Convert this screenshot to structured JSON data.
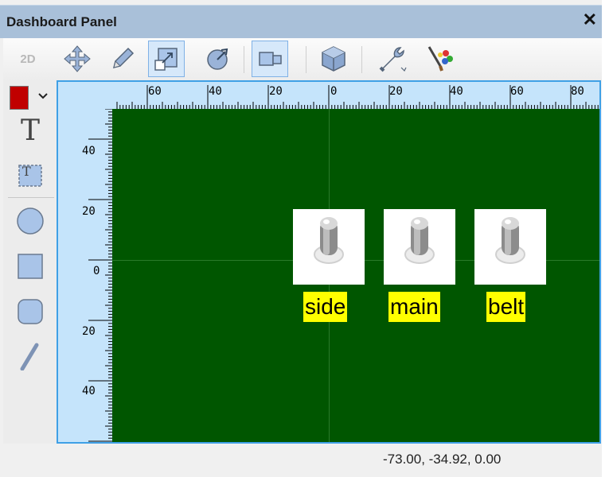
{
  "window": {
    "title": "Dashboard Panel",
    "close_glyph": "✕"
  },
  "toolbar": {
    "mode_label": "2D",
    "buttons": [
      {
        "name": "move-icon",
        "active": false
      },
      {
        "name": "pencil-icon",
        "active": false
      },
      {
        "name": "resize-icon",
        "active": true
      },
      {
        "name": "rotate-icon",
        "active": false
      },
      {
        "name": "attach-icon",
        "active": true
      },
      {
        "name": "cube-icon",
        "active": false
      },
      {
        "name": "wrench-icon",
        "active": false
      },
      {
        "name": "brush-palette-icon",
        "active": false
      }
    ]
  },
  "left_tools": {
    "current_color": "#c00000",
    "text_tool": "T",
    "textbox_tool": "T",
    "items": [
      "text-icon",
      "textbox-icon",
      "circle-icon",
      "rectangle-icon",
      "rounded-rect-icon",
      "line-icon"
    ]
  },
  "rulers": {
    "horizontal": [
      "60",
      "40",
      "20",
      "0",
      "20",
      "40",
      "60",
      "80"
    ],
    "vertical": [
      "40",
      "20",
      "0",
      "20",
      "40"
    ]
  },
  "canvas": {
    "background": "#005600",
    "switches": [
      {
        "label": "side"
      },
      {
        "label": "main"
      },
      {
        "label": "belt"
      }
    ]
  },
  "status": {
    "coordinates": "-73.00, -34.92, 0.00"
  }
}
